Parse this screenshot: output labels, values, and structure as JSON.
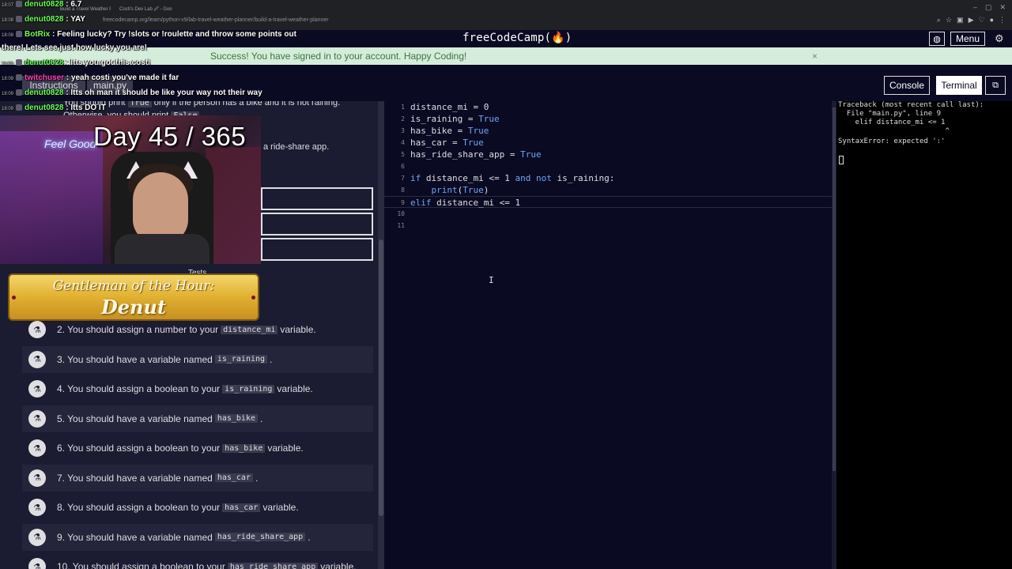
{
  "browser": {
    "tabs": [
      "Build a Travel Weather Pla",
      "Costi's Dev Lab 🖉 - Goo"
    ],
    "url": "freecodecamp.org/learn/python-v9/lab-travel-weather-planner/build-a-travel-weather-planner"
  },
  "nav": {
    "logo": "freeCodeCamp(🔥)",
    "menu_label": "Menu"
  },
  "banner": {
    "message": "Success! You have signed in to your account. Happy Coding!",
    "close": "×"
  },
  "toolbar": {
    "instructions": "Instructions",
    "main_py": "main.py",
    "console": "Console",
    "terminal": "Terminal"
  },
  "instructions": {
    "line1_pre": "You should print",
    "line1_code": "True",
    "line1_post": "only if the person has a bike and it is not raining.",
    "line2_pre": "Otherwise, you should print",
    "line2_code": "False",
    "line3": "a ride-share app.",
    "tests_heading": "Tests"
  },
  "tests": [
    {
      "pre": "2. You should assign a number to your",
      "code": "distance_mi",
      "post": "variable."
    },
    {
      "pre": "3. You should have a variable named",
      "code": "is_raining",
      "post": "."
    },
    {
      "pre": "4. You should assign a boolean to your",
      "code": "is_raining",
      "post": "variable."
    },
    {
      "pre": "5. You should have a variable named",
      "code": "has_bike",
      "post": "."
    },
    {
      "pre": "6. You should assign a boolean to your",
      "code": "has_bike",
      "post": "variable."
    },
    {
      "pre": "7. You should have a variable named",
      "code": "has_car",
      "post": "."
    },
    {
      "pre": "8. You should assign a boolean to your",
      "code": "has_car",
      "post": "variable."
    },
    {
      "pre": "9. You should have a variable named",
      "code": "has_ride_share_app",
      "post": "."
    },
    {
      "pre": "10. You should assign a boolean to your",
      "code": "has_ride_share_app",
      "post": "variable."
    }
  ],
  "editor": {
    "line_numbers": [
      "1",
      "2",
      "3",
      "4",
      "5",
      "6",
      "7",
      "8",
      "9",
      "10",
      "11"
    ],
    "lines": [
      "distance_mi = 0",
      "is_raining = True",
      "has_bike = True",
      "has_car = True",
      "has_ride_share_app = True",
      "",
      "if distance_mi <= 1 and not is_raining:",
      "    print(True)",
      "elif distance_mi <= 1",
      "",
      ""
    ]
  },
  "terminal": {
    "lines": [
      "Traceback (most recent call last):",
      "  File \"main.py\", line 9",
      "    elif distance_mi <= 1",
      "                         ^",
      "SyntaxError: expected ':'"
    ]
  },
  "stream": {
    "chat": [
      {
        "time": "18:07",
        "user": "denut0828",
        "sep": " : ",
        "msg": "6.7"
      },
      {
        "time": "18:08",
        "user": "denut0828",
        "sep": " : ",
        "msg": "YAY"
      },
      {
        "time": "18:08",
        "user": "BotRix",
        "sep": " : ",
        "msg": "Feeling lucky? Try !slots or !roulette and throw some points out"
      },
      {
        "time": "",
        "user": "",
        "sep": "",
        "msg": "there! Lets see just how lucky you are!"
      },
      {
        "time": "18:09",
        "user": "denut0828",
        "sep": " : ",
        "msg": "Itts you got this costi"
      },
      {
        "time": "18:09",
        "user": "twitchuser",
        "sep": " : ",
        "msg": "yeah costi you've made it far"
      },
      {
        "time": "18:09",
        "user": "denut0828",
        "sep": " : ",
        "msg": "Itts oh man it should be like your way not their way"
      },
      {
        "time": "18:09",
        "user": "denut0828",
        "sep": " : ",
        "msg": "Itts DO IT"
      }
    ],
    "day_counter": "Day 45 / 365",
    "neon_sign": "Feel Good",
    "award_title": "Gentleman of the Hour:",
    "award_name": "Denut"
  },
  "colors": {
    "bg": "#0a0a23",
    "panel": "#1b1b32",
    "success_bg": "#d4edda",
    "keyword": "#6da7f0",
    "chat_user": "#6bff5a"
  }
}
